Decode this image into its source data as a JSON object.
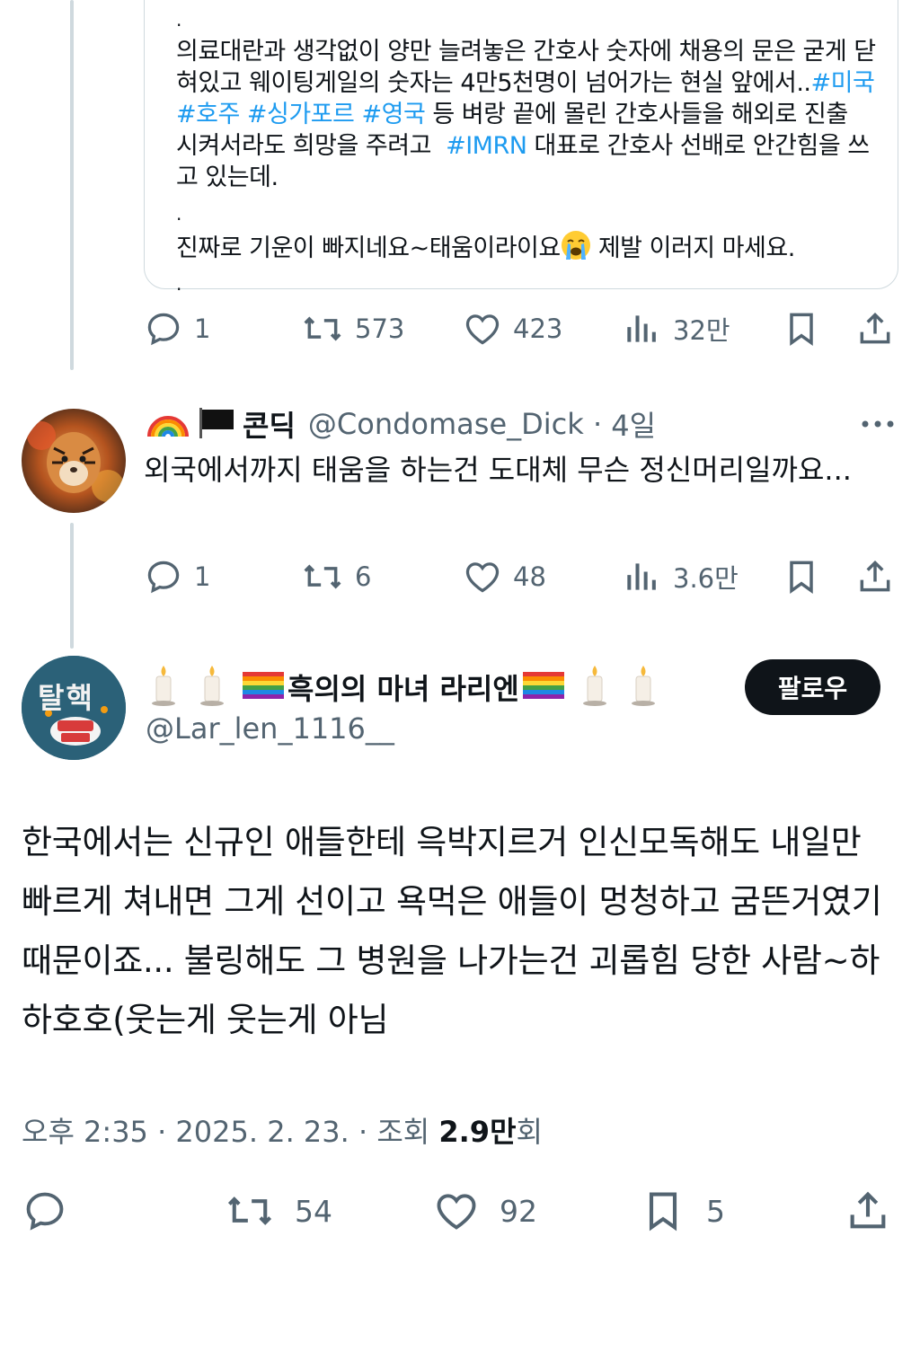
{
  "quoted": {
    "paragraph1_parts": [
      {
        "text": "의료대란과 생각없이 양만 늘려놓은 간호사 숫자에 채용의 문은 굳게 닫혀있고 웨이팅게일의 숫자는 4만5천명이 넘어가는 현실 앞에서..",
        "tag": false
      },
      {
        "text": "#미국",
        "tag": true
      },
      {
        "text": " ",
        "tag": false
      },
      {
        "text": "#호주",
        "tag": true
      },
      {
        "text": " ",
        "tag": false
      },
      {
        "text": "#싱가포르",
        "tag": true
      },
      {
        "text": " ",
        "tag": false
      },
      {
        "text": "#영국",
        "tag": true
      },
      {
        "text": " 등 벼랑 끝에 몰린 간호사들을 해외로 진출 시켜서라도 희망을 주려고  ",
        "tag": false
      },
      {
        "text": "#IMRN",
        "tag": true
      },
      {
        "text": " 대표로 간호사 선배로 안간힘을 쓰고 있는데.",
        "tag": false
      }
    ],
    "dot": ".",
    "paragraph2_before": "진짜로 기운이 빠지네요~태움이라이요",
    "paragraph2_after": " 제발 이러지 마세요."
  },
  "first_post_actions": {
    "replies": "1",
    "reposts": "573",
    "likes": "423",
    "views": "32만"
  },
  "reply": {
    "display_name": "콘딕",
    "handle": "@Condomase_Dick",
    "time": "4일",
    "separator": " · ",
    "text": "외국에서까지 태움을 하는건 도대체 무슨 정신머리일까요...",
    "actions": {
      "replies": "1",
      "reposts": "6",
      "likes": "48",
      "views": "3.6만"
    }
  },
  "main": {
    "display_name": "흑의의 마녀 라리엔",
    "handle": "@Lar_len_1116__",
    "follow_label": "팔로우",
    "avatar_text": "탈핵",
    "text": "한국에서는 신규인 애들한테 윽박지르거 인신모독해도 내일만 빠르게 쳐내면 그게 선이고 욕먹은 애들이 멍청하고 굼뜬거였기 때문이죠... 불링해도 그 병원을 나가는건 괴롭힘 당한 사람~하하호호(웃는게 웃는게 아님",
    "meta_prefix": "오후 2:35 · 2025. 2. 23. · 조회 ",
    "views_number": "2.9만",
    "views_suffix": "회",
    "actions": {
      "reposts": "54",
      "likes": "92",
      "bookmarks": "5"
    }
  },
  "colors": {
    "text": "#0f1419",
    "secondary": "#536471",
    "link": "#1d9bf0",
    "border": "#cfd9de"
  },
  "icons": [
    "reply-icon",
    "repost-icon",
    "like-icon",
    "views-icon",
    "bookmark-icon",
    "share-icon",
    "more-icon",
    "rainbow-flag-icon",
    "black-flag-icon",
    "candle-icon",
    "crying-face-icon"
  ]
}
